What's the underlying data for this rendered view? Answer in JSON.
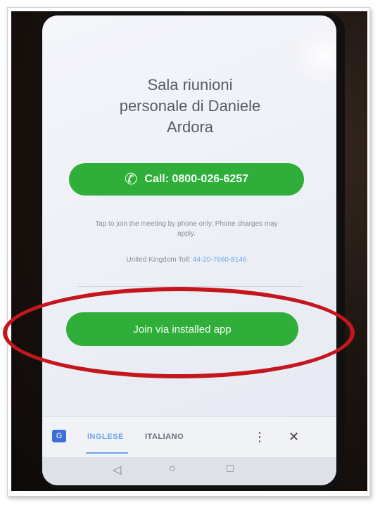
{
  "meeting": {
    "title_line1": "Sala riunioni",
    "title_line2": "personale di Daniele",
    "title_line3": "Ardora"
  },
  "call": {
    "label": "Call: 0800-026-6257",
    "icon": "phone-icon"
  },
  "hint": {
    "text": "Tap to join the meeting by phone only. Phone charges may apply."
  },
  "toll": {
    "label": "United Kingdom Toll:",
    "number": "44-20-7660-8146"
  },
  "join": {
    "label": "Join via installed app"
  },
  "translate_bar": {
    "icon": "translate-icon",
    "languages": [
      "INGLESE",
      "ITALIANO"
    ],
    "more_icon": "more-vertical-icon",
    "close_icon": "close-icon"
  },
  "nav": {
    "back": "◁",
    "home": "○",
    "recent": "□"
  },
  "colors": {
    "accent_green": "#2fae3a",
    "link_blue": "#6aa6e8",
    "highlight_red": "#c4161c"
  }
}
